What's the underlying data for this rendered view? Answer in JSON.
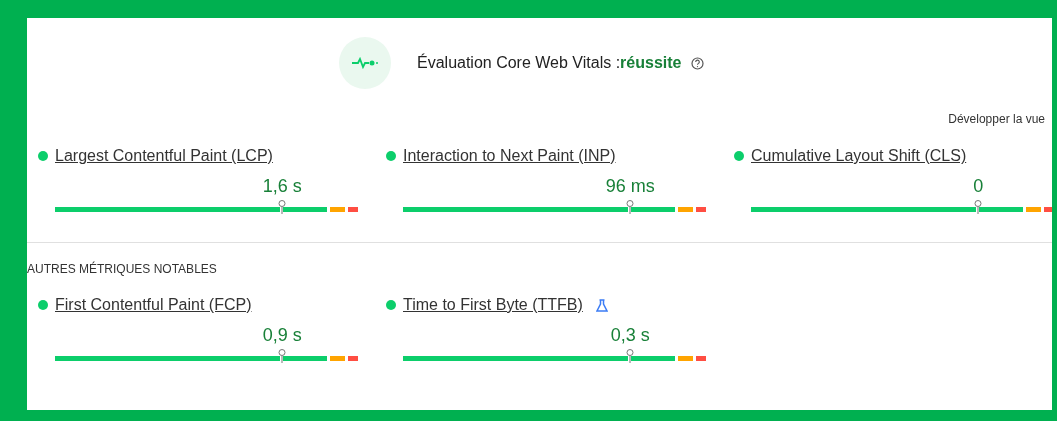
{
  "header": {
    "title": "Évaluation Core Web Vitals :",
    "result": "réussite",
    "expand_link": "Développer la vue"
  },
  "core_metrics": [
    {
      "label": "Largest Contentful Paint (LCP)",
      "value": "1,6 s",
      "level": 0.75,
      "color": "#0cce6b",
      "experimental": false
    },
    {
      "label": "Interaction to Next Paint (INP)",
      "value": "96 ms",
      "level": 0.75,
      "color": "#0cce6b",
      "experimental": false
    },
    {
      "label": "Cumulative Layout Shift (CLS)",
      "value": "0",
      "level": 0.75,
      "color": "#0cce6b",
      "experimental": false
    }
  ],
  "other_section": {
    "title": "AUTRES MÉTRIQUES NOTABLES"
  },
  "other_metrics": [
    {
      "label": "First Contentful Paint (FCP)",
      "value": "0,9 s",
      "level": 0.75,
      "color": "#0cce6b",
      "experimental": false
    },
    {
      "label": "Time to First Byte (TTFB)",
      "value": "0,3 s",
      "level": 0.75,
      "color": "#0cce6b",
      "experimental": true
    }
  ]
}
